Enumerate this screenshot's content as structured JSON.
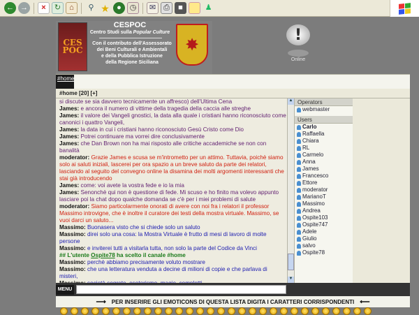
{
  "header": {
    "title": "CESPOC",
    "subtitle_prefix": "Centro Studi sulla ",
    "subtitle_italic": "Popular Culture",
    "desc": [
      "Con il contributo dell'Assessorato",
      "dei Beni Culturali e Ambientali",
      "e della Pubblica Istruzione",
      "della Regione Siciliana"
    ],
    "logo_text": "CES POC"
  },
  "status": {
    "label": "Online",
    "icon": "exclamation-bubble-icon"
  },
  "tab": {
    "label": "#home"
  },
  "channel_bar": "#home [20] [+]",
  "chat": [
    {
      "type": "text",
      "text": "si discute se sia davvero tecnicamente un affresco) dell'Ultima Cena"
    },
    {
      "type": "james",
      "name": "James:",
      "text": " e ancora il numero di vittime della tragedia della caccia alle streghe"
    },
    {
      "type": "james",
      "name": "James:",
      "text": " il valore dei Vangeli gnostici, la data alla quale i cristiani hanno riconosciuto come canonici i quattro Vangeli,"
    },
    {
      "type": "james",
      "name": "James:",
      "text": " la data in cui i cristiani hanno riconosciuto Gesù Cristo come Dio"
    },
    {
      "type": "james",
      "name": "James:",
      "text": " Potrei continuare ma vorrei dire conclusivamente"
    },
    {
      "type": "james",
      "name": "James:",
      "text": " che Dan Brown non ha mai risposto alle critiche accademiche se non con banalità"
    },
    {
      "type": "mod",
      "name": "moderator:",
      "text": " Grazie James e scusa se m'intrometto per un attimo. Tuttavia, poichè siamo solo ai saluti iniziali, lascerei per ora spazio a un breve saluto da parte dei relatori, lasciando al seguito del convegno online la disamina dei molti argomenti interessanti che stai già introducendo"
    },
    {
      "type": "james",
      "name": "James:",
      "text": " come: voi avete la vostra fede e io la mia"
    },
    {
      "type": "james",
      "name": "James:",
      "text": " Senonchè qui non è questione di fede. Mi scuso e ho finito ma volevo appunto lasciare poi la chat dopo qualche domanda se c'è per i miei problemi di salute"
    },
    {
      "type": "mod",
      "name": "moderator:",
      "text": " Siamo particolarmente onorati di avere con noi fra i relatori il professor Massimo introvigne, che è inoltre il curatore dei testi della mostra virtuale. Massimo, se vuoi darci un saluto..."
    },
    {
      "type": "mas",
      "name": "Massimo:",
      "text": " Buonasera visto che si chiede solo un saluto"
    },
    {
      "type": "mas",
      "name": "Massimo:",
      "text": " direi solo una cosa: la Mostra Virtuale è frutto di mesi di lavoro di molte persone"
    },
    {
      "type": "mas",
      "name": "Massimo:",
      "text": " e inviterei tutti a visitarla tutta, non solo la parte del Codice da Vinci"
    },
    {
      "type": "sys",
      "pre": "## L'utente ",
      "user": "Ospite78",
      "post": " ha scelto il canale #home"
    },
    {
      "type": "mas",
      "name": "Massimo:",
      "text": " perchè abbiamo precisamente voluto mostrare"
    },
    {
      "type": "mas",
      "name": "Massimo:",
      "text": " che una letteratura venduta a decine di milioni di copie e che parlava di misteri,"
    },
    {
      "type": "mas",
      "name": "Massimo:",
      "text": " società segrete, esoterismo, magie, complotti,"
    }
  ],
  "operators_header": "Operators",
  "operators": [
    "webmaster"
  ],
  "users_header": "Users",
  "users": [
    "Carlo",
    "Raffaella",
    "Chiara",
    "RL",
    "Carmelo",
    "Anna",
    "James",
    "Francesco",
    "Ettore",
    "moderator",
    "MarianoT",
    "Massimo",
    "Andrea",
    "Ospite103",
    "Ospite747",
    "Adele",
    "Giulio",
    "salvo",
    "Ospite78"
  ],
  "menu_label": "MENU",
  "emoticon_bar": "PER INSERIRE GLI EMOTICONS DI QUESTA LISTA DIGITA I CARATTERI CORRISPONDENTI",
  "colors": {
    "page_bg": "#7c7c7c",
    "moderator": "#d0200f",
    "massimo": "#2020b0",
    "james_text": "#601e70",
    "system": "#1a7a1a"
  }
}
